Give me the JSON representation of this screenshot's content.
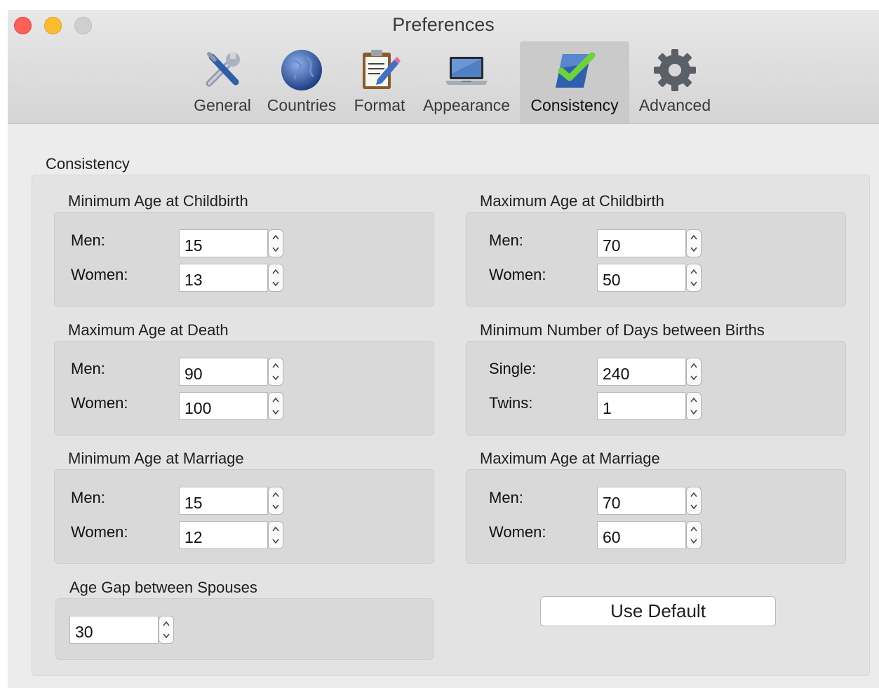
{
  "window": {
    "title": "Preferences"
  },
  "toolbar": {
    "items": [
      {
        "label": "General",
        "icon": "tools-icon"
      },
      {
        "label": "Countries",
        "icon": "globe-icon"
      },
      {
        "label": "Format",
        "icon": "clipboard-pencil-icon"
      },
      {
        "label": "Appearance",
        "icon": "laptop-icon"
      },
      {
        "label": "Consistency",
        "icon": "checkmark-icon",
        "selected": true
      },
      {
        "label": "Advanced",
        "icon": "gear-icon"
      }
    ]
  },
  "consistency": {
    "title": "Consistency",
    "min_age_childbirth": {
      "title": "Minimum Age at Childbirth",
      "men_label": "Men:",
      "men": "15",
      "women_label": "Women:",
      "women": "13"
    },
    "max_age_childbirth": {
      "title": "Maximum Age at Childbirth",
      "men_label": "Men:",
      "men": "70",
      "women_label": "Women:",
      "women": "50"
    },
    "max_age_death": {
      "title": "Maximum Age at Death",
      "men_label": "Men:",
      "men": "90",
      "women_label": "Women:",
      "women": "100"
    },
    "min_days_births": {
      "title": "Minimum Number of Days between Births",
      "single_label": "Single:",
      "single": "240",
      "twins_label": "Twins:",
      "twins": "1"
    },
    "min_age_marriage": {
      "title": "Minimum Age at Marriage",
      "men_label": "Men:",
      "men": "15",
      "women_label": "Women:",
      "women": "12"
    },
    "max_age_marriage": {
      "title": "Maximum Age at Marriage",
      "men_label": "Men:",
      "men": "70",
      "women_label": "Women:",
      "women": "60"
    },
    "age_gap": {
      "title": "Age Gap between Spouses",
      "value": "30"
    },
    "use_default_label": "Use Default"
  },
  "colors": {
    "close": "#fc5f57",
    "minimize": "#fdbc2e",
    "maximize_disabled": "#cfcfcf",
    "selected_tab": "#cacaca",
    "window_bg": "#ececec"
  }
}
